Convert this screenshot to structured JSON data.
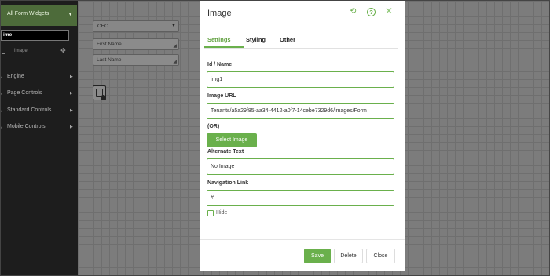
{
  "sidebar": {
    "header_label": "All Form Widgets",
    "search_value": "ime",
    "widget_item_label": "Image",
    "nav": [
      {
        "label": "Engine"
      },
      {
        "label": "Page Controls"
      },
      {
        "label": "Standard Controls"
      },
      {
        "label": "Mobile Controls"
      }
    ]
  },
  "canvas": {
    "select_value": "CEO",
    "first_name_placeholder": "First Name",
    "last_name_placeholder": "Last Name"
  },
  "modal": {
    "title": "Image",
    "tabs": [
      {
        "label": "Settings",
        "active": true
      },
      {
        "label": "Styling",
        "active": false
      },
      {
        "label": "Other",
        "active": false
      }
    ],
    "fields": {
      "id_label": "Id / Name",
      "id_value": "img1",
      "url_label": "Image URL",
      "url_value": "Tenants/a5a29f85-aa34-4412-a0f7-14cebe7329d6/images/Form",
      "or_label": "(OR)",
      "select_image_label": "Select Image",
      "alt_label": "Alternate Text",
      "alt_value": "No Image",
      "nav_label": "Navigation Link",
      "nav_value": "#",
      "hide_label": "Hide"
    },
    "buttons": {
      "save": "Save",
      "delete": "Delete",
      "close": "Close"
    }
  },
  "colors": {
    "accent": "#6ab04c",
    "sidebar_bg": "#1d1d1d",
    "overlay": "#7c7c7c"
  }
}
